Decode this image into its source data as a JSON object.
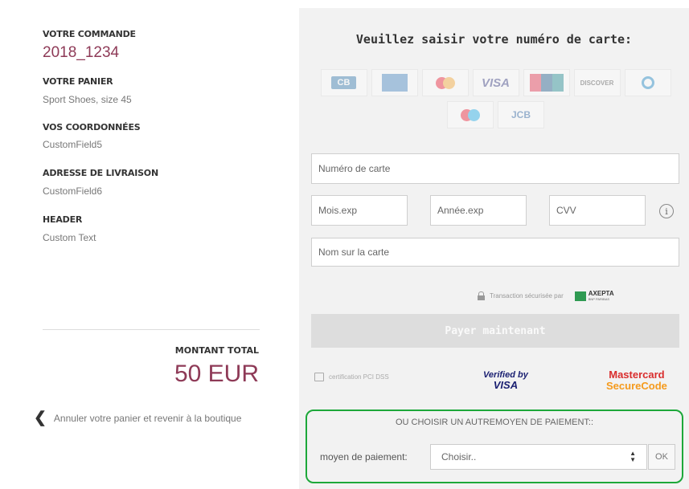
{
  "summary": {
    "order_title": "VOTRE COMMANDE",
    "order_number": "2018_1234",
    "cart_title": "VOTRE PANIER",
    "cart_value": "Sport Shoes, size 45",
    "contact_title": "VOS COORDONNÉES",
    "contact_value": "CustomField5",
    "delivery_title": "ADRESSE DE LIVRAISON",
    "delivery_value": "CustomField6",
    "header_title": "HEADER",
    "header_value": "Custom Text",
    "total_label": "MONTANT TOTAL",
    "total_amount": "50 EUR",
    "cancel_link": "Annuler votre panier et revenir à la boutique"
  },
  "payment": {
    "title": "Veuillez saisir votre numéro de carte:",
    "card_logos": [
      {
        "icon": "cb-logo",
        "label": "CB"
      },
      {
        "icon": "amex-logo",
        "label": ""
      },
      {
        "icon": "mastercard-logo",
        "label": ""
      },
      {
        "icon": "visa-logo",
        "label": "VISA"
      },
      {
        "icon": "unionpay-logo",
        "label": ""
      },
      {
        "icon": "discover-logo",
        "label": "DISCOVER"
      },
      {
        "icon": "diners-logo",
        "label": ""
      },
      {
        "icon": "maestro-logo",
        "label": ""
      },
      {
        "icon": "jcb-logo",
        "label": "JCB"
      }
    ],
    "card_number_placeholder": "Numéro de carte",
    "exp_month_placeholder": "Mois.exp",
    "exp_year_placeholder": "Année.exp",
    "cvv_placeholder": "CVV",
    "cardholder_placeholder": "Nom sur la carte",
    "info_icon": "i",
    "secure_text": "Transaction sécurisée par",
    "axepta_name": "AXEPTA",
    "axepta_sub": "BNP PARIBAS",
    "pay_button": "Payer maintenant",
    "pci_text": "certification PCI DSS",
    "vbv_line1": "Verified by",
    "vbv_line2": "VISA",
    "mc_line1": "Mastercard",
    "mc_line2": "SecureCode"
  },
  "alternative": {
    "title": "OU CHOISIR UN AUTREMOYEN DE PAIEMENT::",
    "label": "moyen de paiement:",
    "selected": "Choisir..",
    "ok_button": "OK"
  },
  "colors": {
    "accent": "#8e3a57",
    "highlight_border": "#1da83a",
    "panel_bg": "#f2f2f2"
  }
}
